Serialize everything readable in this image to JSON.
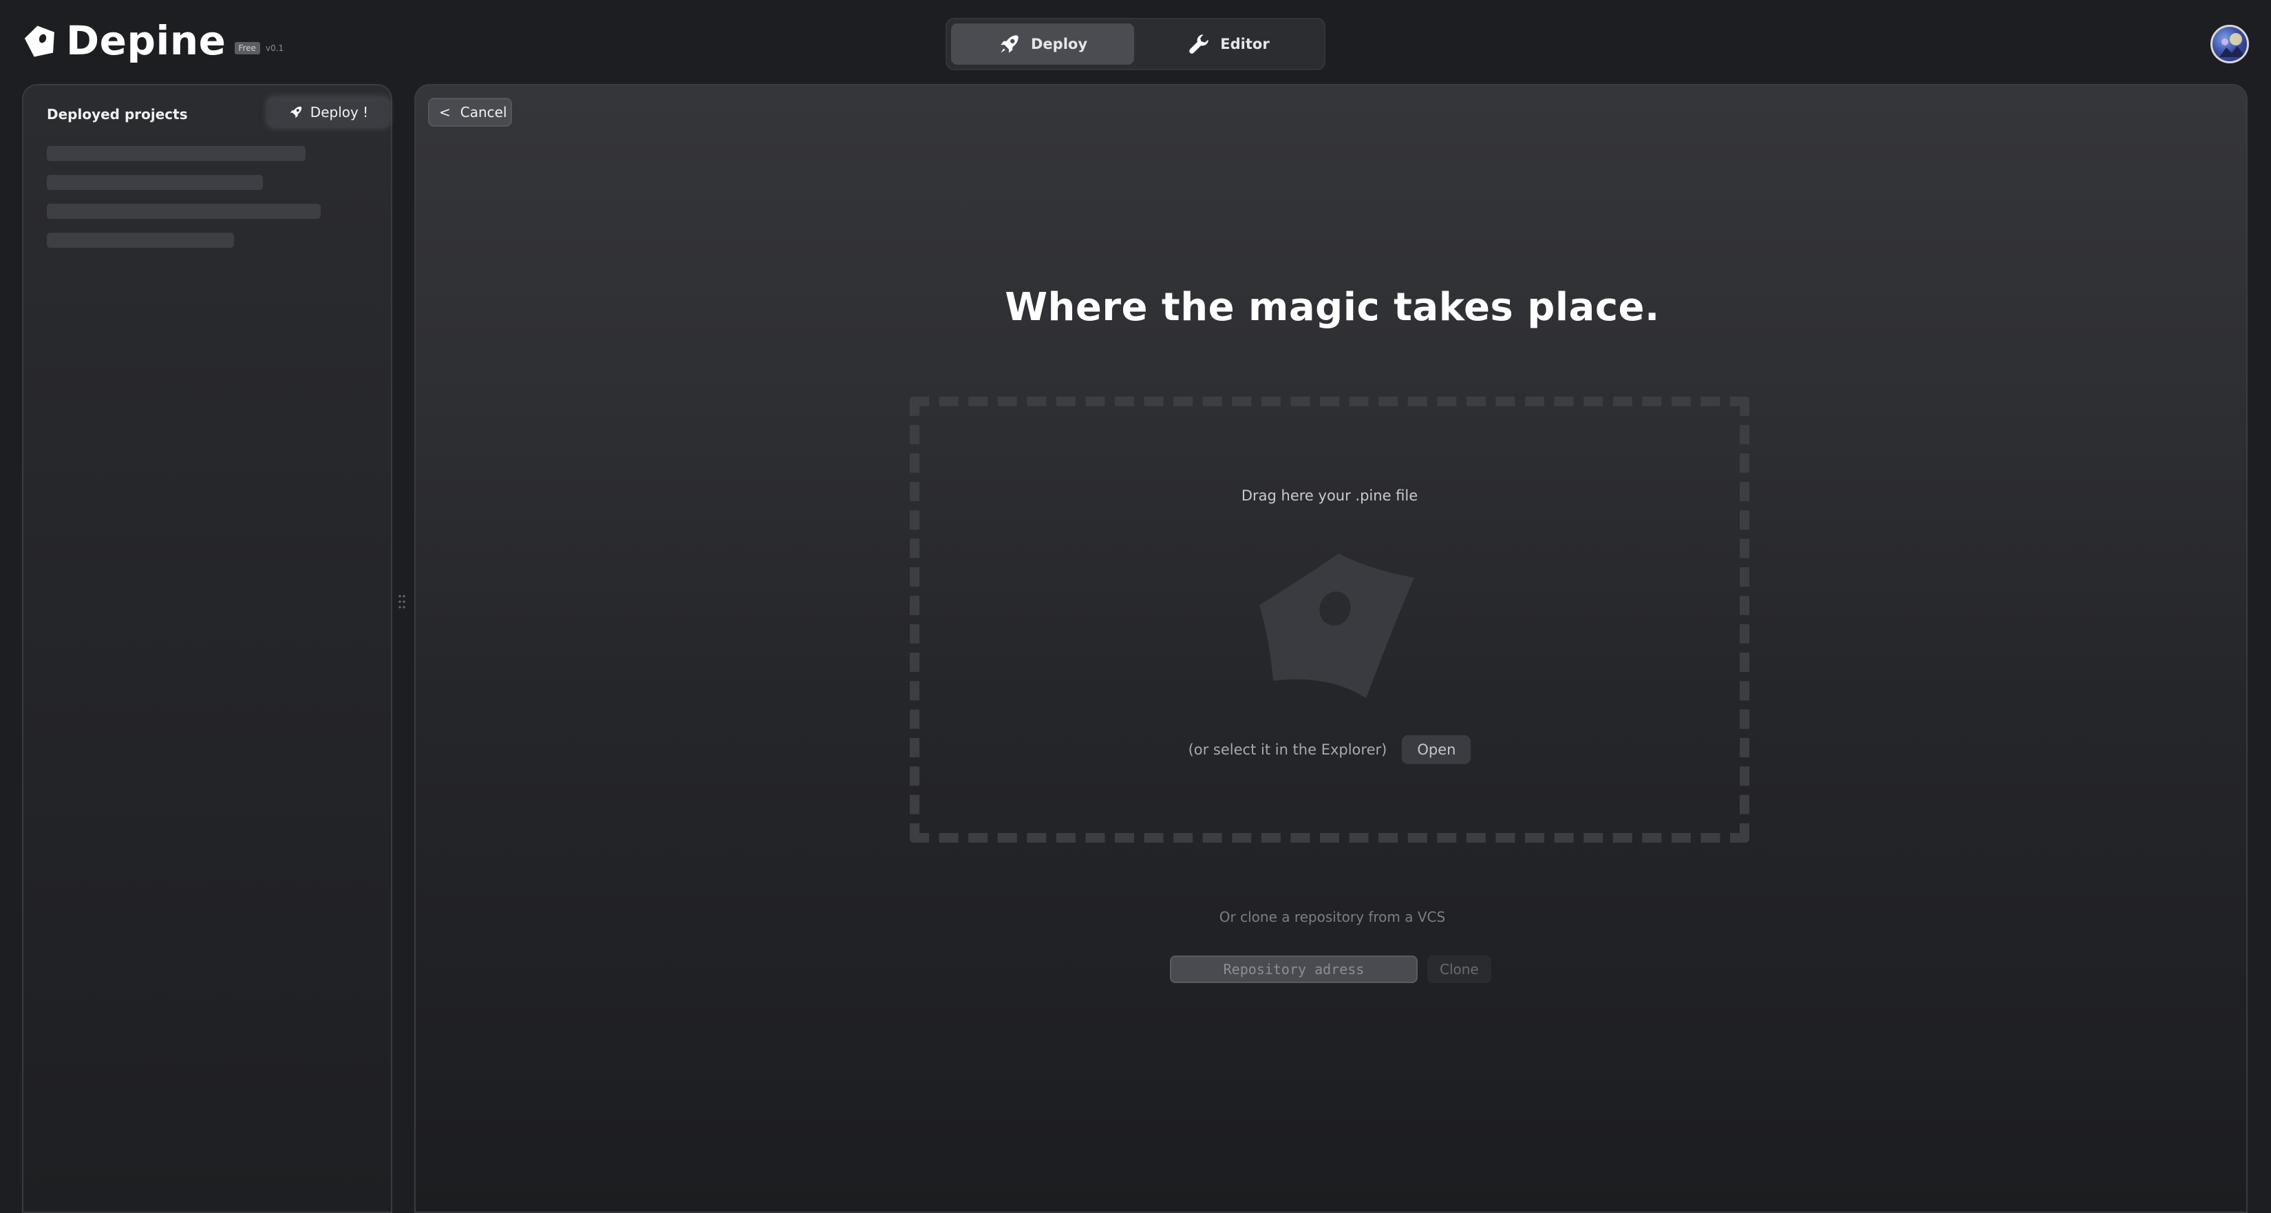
{
  "app": {
    "name": "Depine",
    "badge": "Free",
    "version": "v0.1"
  },
  "mode_switch": {
    "deploy_label": "Deploy",
    "editor_label": "Editor",
    "active": "deploy"
  },
  "sidebar": {
    "title": "Deployed projects",
    "deploy_button": "Deploy !",
    "skeleton_count": 4
  },
  "main": {
    "cancel_label": "Cancel",
    "cancel_icon": "<",
    "headline": "Where the magic takes place.",
    "dropzone": {
      "instruction": "Drag here your .pine file",
      "select_text": "(or select it in the Explorer)",
      "open_button": "Open"
    },
    "vcs": {
      "text": "Or clone a repository from a VCS",
      "input_placeholder": "Repository adress",
      "clone_button": "Clone"
    }
  },
  "colors": {
    "background": "#1d1e21",
    "panel": "#2b2c30",
    "active_tab": "#4a4c52",
    "text": "#ffffff"
  },
  "icons": {
    "logo": "pine-logo-icon",
    "deploy": "rocket-icon",
    "editor": "wrench-icon",
    "dropzone": "pine-file-icon",
    "resize": "grip-icon"
  }
}
